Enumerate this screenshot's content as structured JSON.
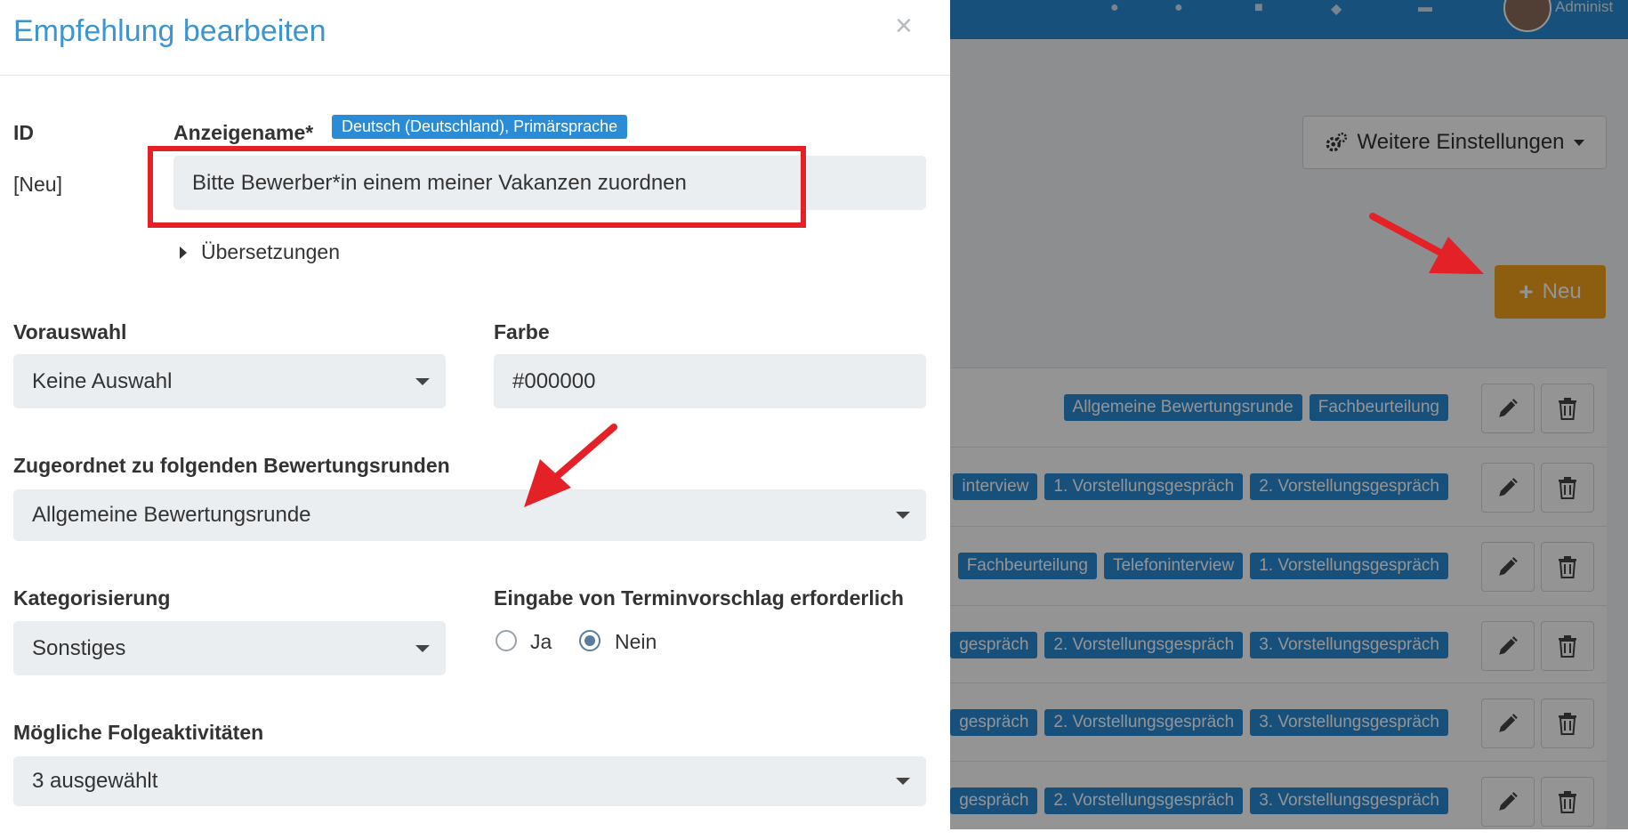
{
  "background": {
    "topbar": {
      "user_role": "Administ",
      "color": "#2a8bd6"
    },
    "settings_button_label": "Weitere Einstellungen",
    "new_button_label": "Neu",
    "rows": [
      {
        "tags": [
          "Allgemeine Bewertungsrunde",
          "Fachbeurteilung"
        ]
      },
      {
        "tags": [
          "interview",
          "1. Vorstellungsgespräch",
          "2. Vorstellungsgespräch"
        ]
      },
      {
        "tags": [
          "Fachbeurteilung",
          "Telefoninterview",
          "1. Vorstellungsgespräch"
        ]
      },
      {
        "tags": [
          "gespräch",
          "2. Vorstellungsgespräch",
          "3. Vorstellungsgespräch"
        ]
      },
      {
        "tags": [
          "gespräch",
          "2. Vorstellungsgespräch",
          "3. Vorstellungsgespräch"
        ]
      },
      {
        "tags": [
          "gespräch",
          "2. Vorstellungsgespräch",
          "3. Vorstellungsgespräch"
        ]
      }
    ],
    "icons": [
      "pencil-icon",
      "trash-icon",
      "gear-icon",
      "plus-icon"
    ]
  },
  "modal": {
    "title": "Empfehlung bearbeiten",
    "close_symbol": "×",
    "id_label": "ID",
    "id_value": "[Neu]",
    "display_name_label": "Anzeigename*",
    "language_badge": "Deutsch (Deutschland), Primärsprache",
    "display_name_value": "Bitte Bewerber*in einem meiner Vakanzen zuordnen",
    "translations_toggle": "Übersetzungen",
    "preselection_label": "Vorauswahl",
    "preselection_value": "Keine Auswahl",
    "color_label": "Farbe",
    "color_value": "#000000",
    "rounds_label": "Zugeordnet zu folgenden Bewertungsrunden",
    "rounds_value": "Allgemeine Bewertungsrunde",
    "category_label": "Kategorisierung",
    "category_value": "Sonstiges",
    "appointment_label": "Eingabe von Terminvorschlag erforderlich",
    "radio_yes": "Ja",
    "radio_no": "Nein",
    "radio_selected": "Nein",
    "followups_label": "Mögliche Folgeaktivitäten",
    "followups_value": "3 ausgewählt"
  },
  "annotations": {
    "color": "#e52128"
  }
}
